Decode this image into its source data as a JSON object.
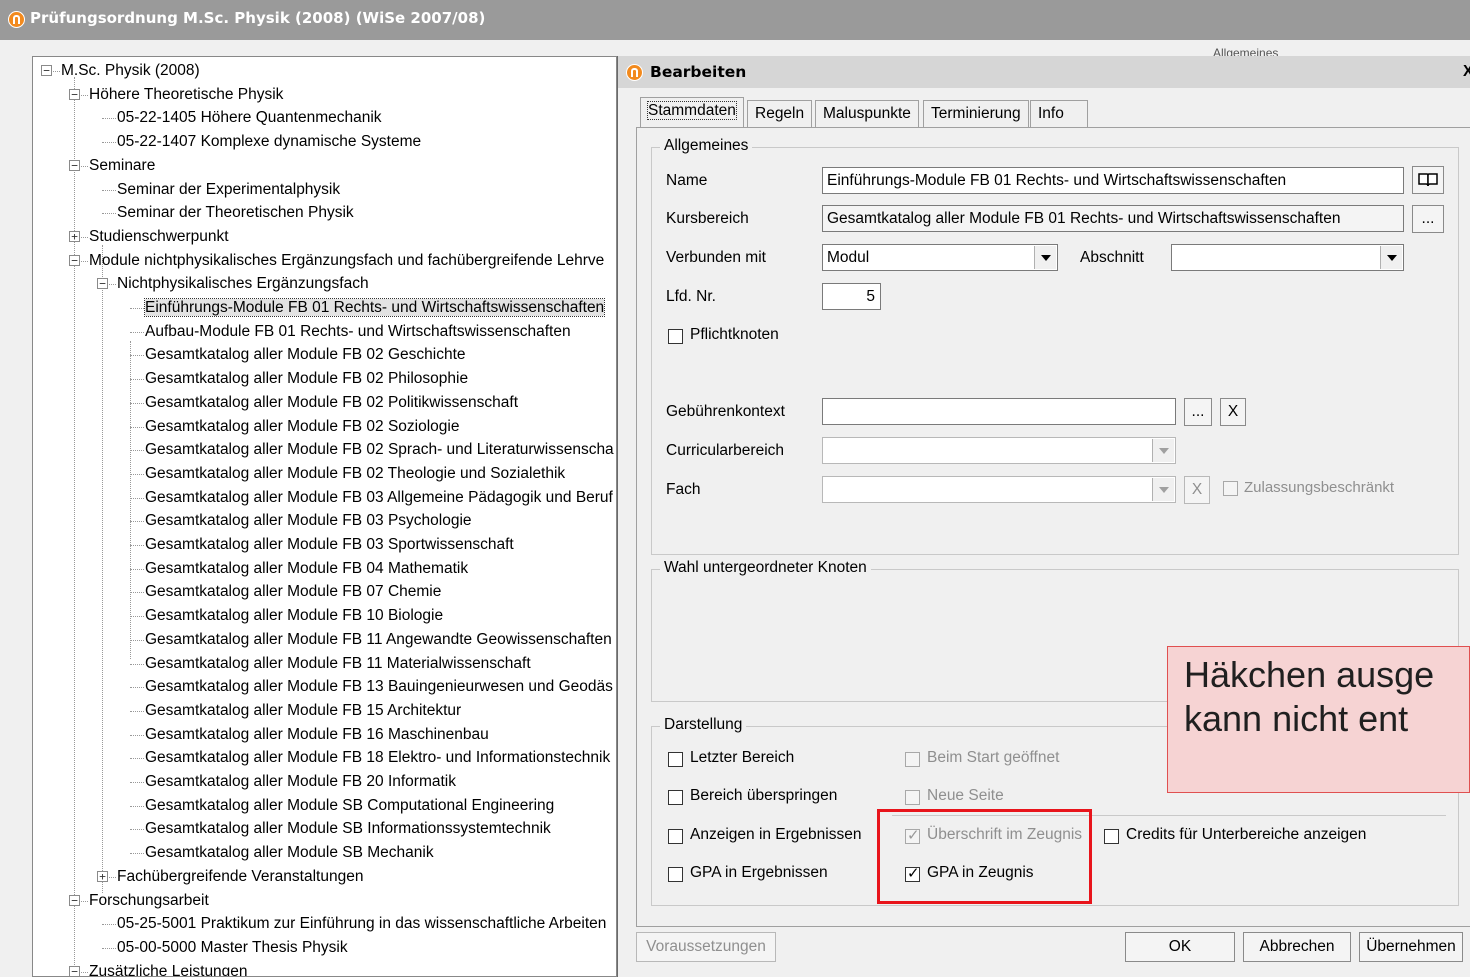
{
  "window": {
    "title": "Prüfungsordnung M.Sc. Physik (2008) (WiSe 2007/08)",
    "bg_label": "Allgemeines"
  },
  "tree": {
    "items": [
      {
        "label": "M.Sc. Physik (2008)",
        "level": 0,
        "expander": "−"
      },
      {
        "label": "Höhere Theoretische Physik",
        "level": 1,
        "expander": "−"
      },
      {
        "label": "05-22-1405 Höhere Quantenmechanik",
        "level": 2
      },
      {
        "label": "05-22-1407 Komplexe dynamische Systeme",
        "level": 2
      },
      {
        "label": "Seminare",
        "level": 1,
        "expander": "−"
      },
      {
        "label": "Seminar der Experimentalphysik",
        "level": 2
      },
      {
        "label": "Seminar der Theoretischen Physik",
        "level": 2
      },
      {
        "label": "Studienschwerpunkt",
        "level": 1,
        "expander": "+"
      },
      {
        "label": "Module nichtphysikalisches Ergänzungsfach und fachübergreifende Lehrve",
        "level": 1,
        "expander": "−"
      },
      {
        "label": "Nichtphysikalisches Ergänzungsfach",
        "level": 2,
        "expander": "−"
      },
      {
        "label": "Einführungs-Module FB 01 Rechts- und Wirtschaftswissenschaften",
        "level": 3,
        "selected": true
      },
      {
        "label": "Aufbau-Module FB 01 Rechts- und Wirtschaftswissenschaften",
        "level": 3
      },
      {
        "label": "Gesamtkatalog aller Module FB 02 Geschichte",
        "level": 3
      },
      {
        "label": "Gesamtkatalog aller Module FB 02 Philosophie",
        "level": 3
      },
      {
        "label": "Gesamtkatalog aller Module FB 02 Politikwissenschaft",
        "level": 3
      },
      {
        "label": "Gesamtkatalog aller Module FB 02 Soziologie",
        "level": 3
      },
      {
        "label": "Gesamtkatalog aller Module FB 02 Sprach- und Literaturwissenscha",
        "level": 3
      },
      {
        "label": "Gesamtkatalog aller Module FB 02 Theologie und Sozialethik",
        "level": 3
      },
      {
        "label": "Gesamtkatalog aller Module FB 03 Allgemeine Pädagogik und Beruf",
        "level": 3
      },
      {
        "label": "Gesamtkatalog aller Module FB 03 Psychologie",
        "level": 3
      },
      {
        "label": "Gesamtkatalog aller Module FB 03 Sportwissenschaft",
        "level": 3
      },
      {
        "label": "Gesamtkatalog aller Module FB 04 Mathematik",
        "level": 3
      },
      {
        "label": "Gesamtkatalog aller Module FB 07 Chemie",
        "level": 3
      },
      {
        "label": "Gesamtkatalog aller Module FB 10 Biologie",
        "level": 3
      },
      {
        "label": "Gesamtkatalog aller Module FB 11 Angewandte Geowissenschaften",
        "level": 3
      },
      {
        "label": "Gesamtkatalog aller Module FB 11 Materialwissenschaft",
        "level": 3
      },
      {
        "label": "Gesamtkatalog aller Module FB 13 Bauingenieurwesen und Geodäs",
        "level": 3
      },
      {
        "label": "Gesamtkatalog aller Module FB 15 Architektur",
        "level": 3
      },
      {
        "label": "Gesamtkatalog aller Module FB 16 Maschinenbau",
        "level": 3
      },
      {
        "label": "Gesamtkatalog aller Module FB 18 Elektro- und Informationstechnik",
        "level": 3
      },
      {
        "label": "Gesamtkatalog aller Module FB 20 Informatik",
        "level": 3
      },
      {
        "label": "Gesamtkatalog aller Module SB Computational Engineering",
        "level": 3
      },
      {
        "label": "Gesamtkatalog aller Module SB Informationssystemtechnik",
        "level": 3
      },
      {
        "label": "Gesamtkatalog aller Module SB Mechanik",
        "level": 3
      },
      {
        "label": "Fachübergreifende Veranstaltungen",
        "level": 2,
        "expander": "+"
      },
      {
        "label": "Forschungsarbeit",
        "level": 1,
        "expander": "−"
      },
      {
        "label": "05-25-5001 Praktikum zur Einführung in das wissenschaftliche Arbeiten",
        "level": 2
      },
      {
        "label": "05-00-5000 Master Thesis Physik",
        "level": 2
      },
      {
        "label": "Zusätzliche Leistungen",
        "level": 1,
        "expander": "−"
      }
    ]
  },
  "dialog": {
    "title": "Bearbeiten",
    "close_glyph": "X",
    "tabs": [
      "Stammdaten",
      "Regeln",
      "Maluspunkte",
      "Terminierung",
      "Info"
    ],
    "active_tab": "Stammdaten",
    "allgemeines": {
      "caption": "Allgemeines",
      "name_label": "Name",
      "name_value": "Einführungs-Module FB 01 Rechts- und Wirtschaftswissenschaften",
      "kursbereich_label": "Kursbereich",
      "kursbereich_value": "Gesamtkatalog aller Module FB 01 Rechts- und Wirtschaftswissenschaften",
      "kursbereich_btn": "...",
      "verbunden_label": "Verbunden mit",
      "verbunden_value": "Modul",
      "abschnitt_label": "Abschnitt",
      "abschnitt_value": "",
      "lfdnr_label": "Lfd. Nr.",
      "lfdnr_value": "5",
      "pflicht_label": "Pflichtknoten",
      "gebuehren_label": "Gebührenkontext",
      "gebuehren_value": "",
      "gebuehren_btn": "...",
      "gebuehren_clear": "X",
      "curricular_label": "Curricularbereich",
      "fach_label": "Fach",
      "fach_clear": "X",
      "zulassung_label": "Zulassungsbeschränkt"
    },
    "wahl": {
      "caption": "Wahl untergeordneter Knoten"
    },
    "darstellung": {
      "caption": "Darstellung",
      "letzter_bereich": "Letzter Bereich",
      "beim_start": "Beim Start geöffnet",
      "bereich_ueberspringen": "Bereich überspringen",
      "neue_seite": "Neue Seite",
      "anzeigen_ergebnissen": "Anzeigen in Ergebnissen",
      "ueberschrift_zeugnis": "Überschrift im Zeugnis",
      "credits_unterbereiche": "Credits für Unterbereiche anzeigen",
      "gpa_ergebnissen": "GPA in Ergebnissen",
      "gpa_zeugnis": "GPA in Zeugnis"
    },
    "buttons": {
      "voraussetzungen": "Voraussetzungen",
      "ok": "OK",
      "abbrechen": "Abbrechen",
      "uebernehmen": "Übernehmen"
    }
  },
  "annotation": {
    "line1": "Häkchen ausge",
    "line2": "kann nicht ent",
    "highlight_color": "#e8141b"
  }
}
